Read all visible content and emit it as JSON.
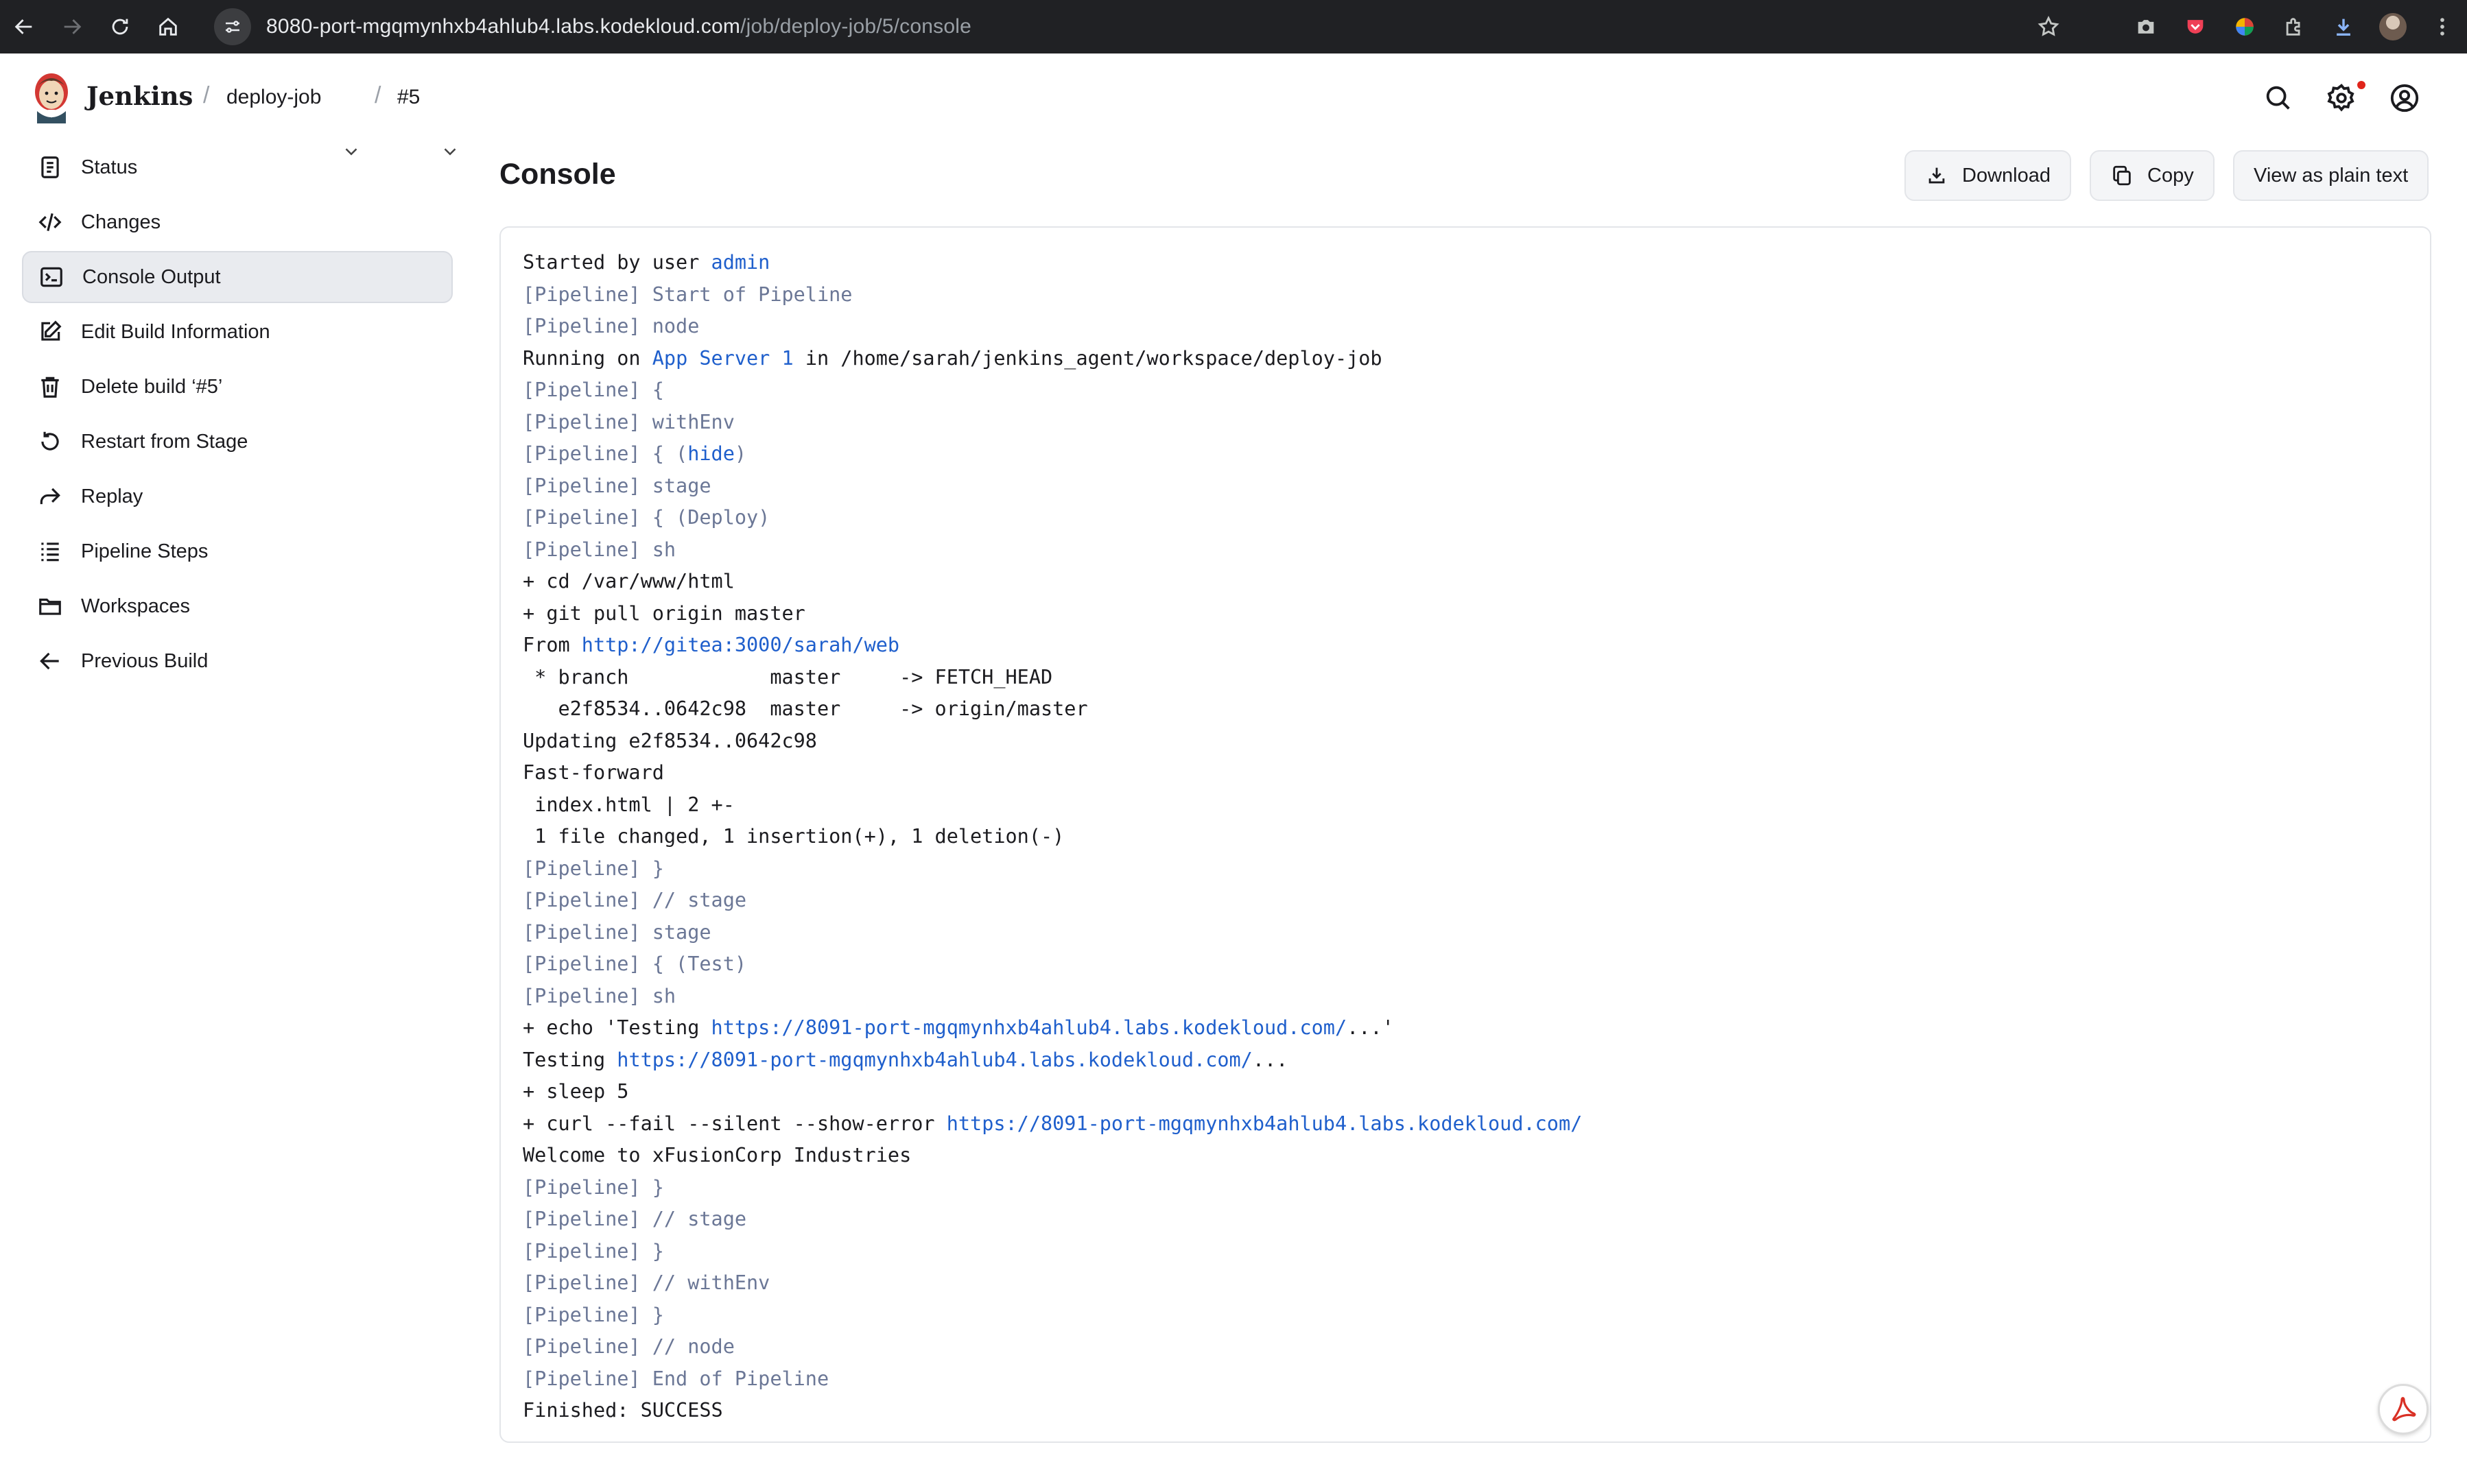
{
  "browser": {
    "url_host": "8080-port-mgqmynhxb4ahlub4.labs.kodekloud.com",
    "url_path": "/job/deploy-job/5/console"
  },
  "header": {
    "brand": "Jenkins",
    "breadcrumb": [
      {
        "label": "deploy-job"
      },
      {
        "label": "#5"
      }
    ],
    "separator": "/"
  },
  "sidebar": {
    "items": [
      {
        "label": "Status",
        "icon": "document-icon"
      },
      {
        "label": "Changes",
        "icon": "code-icon"
      },
      {
        "label": "Console Output",
        "icon": "terminal-icon",
        "active": true
      },
      {
        "label": "Edit Build Information",
        "icon": "edit-icon"
      },
      {
        "label": "Delete build ‘#5’",
        "icon": "trash-icon"
      },
      {
        "label": "Restart from Stage",
        "icon": "restart-icon"
      },
      {
        "label": "Replay",
        "icon": "replay-icon"
      },
      {
        "label": "Pipeline Steps",
        "icon": "list-icon"
      },
      {
        "label": "Workspaces",
        "icon": "folder-icon"
      },
      {
        "label": "Previous Build",
        "icon": "arrow-left-icon"
      }
    ]
  },
  "main": {
    "title": "Console",
    "buttons": {
      "download": "Download",
      "copy": "Copy",
      "plain_text": "View as plain text"
    }
  },
  "console": {
    "lines": [
      [
        {
          "t": "Started by user "
        },
        {
          "t": "admin",
          "c": "lnk"
        }
      ],
      [
        {
          "t": "[Pipeline] Start of Pipeline",
          "c": "pl"
        }
      ],
      [
        {
          "t": "[Pipeline] node",
          "c": "pl"
        }
      ],
      [
        {
          "t": "Running on "
        },
        {
          "t": "App Server 1",
          "c": "lnk"
        },
        {
          "t": " in /home/sarah/jenkins_agent/workspace/deploy-job"
        }
      ],
      [
        {
          "t": "[Pipeline] {",
          "c": "pl"
        }
      ],
      [
        {
          "t": "[Pipeline] withEnv",
          "c": "pl"
        }
      ],
      [
        {
          "t": "[Pipeline] { (",
          "c": "pl"
        },
        {
          "t": "hide",
          "c": "lnk"
        },
        {
          "t": ")",
          "c": "pl"
        }
      ],
      [
        {
          "t": "[Pipeline] stage",
          "c": "pl"
        }
      ],
      [
        {
          "t": "[Pipeline] { (Deploy)",
          "c": "pl"
        }
      ],
      [
        {
          "t": "[Pipeline] sh",
          "c": "pl"
        }
      ],
      [
        {
          "t": "+ cd /var/www/html"
        }
      ],
      [
        {
          "t": "+ git pull origin master"
        }
      ],
      [
        {
          "t": "From "
        },
        {
          "t": "http://gitea:3000/sarah/web",
          "c": "lnk"
        }
      ],
      [
        {
          "t": " * branch            master     -> FETCH_HEAD"
        }
      ],
      [
        {
          "t": "   e2f8534..0642c98  master     -> origin/master"
        }
      ],
      [
        {
          "t": "Updating e2f8534..0642c98"
        }
      ],
      [
        {
          "t": "Fast-forward"
        }
      ],
      [
        {
          "t": " index.html | 2 +-"
        }
      ],
      [
        {
          "t": " 1 file changed, 1 insertion(+), 1 deletion(-)"
        }
      ],
      [
        {
          "t": "[Pipeline] }",
          "c": "pl"
        }
      ],
      [
        {
          "t": "[Pipeline] // stage",
          "c": "pl"
        }
      ],
      [
        {
          "t": "[Pipeline] stage",
          "c": "pl"
        }
      ],
      [
        {
          "t": "[Pipeline] { (Test)",
          "c": "pl"
        }
      ],
      [
        {
          "t": "[Pipeline] sh",
          "c": "pl"
        }
      ],
      [
        {
          "t": "+ echo 'Testing "
        },
        {
          "t": "https://8091-port-mgqmynhxb4ahlub4.labs.kodekloud.com/",
          "c": "lnk"
        },
        {
          "t": "...'"
        }
      ],
      [
        {
          "t": "Testing "
        },
        {
          "t": "https://8091-port-mgqmynhxb4ahlub4.labs.kodekloud.com/",
          "c": "lnk"
        },
        {
          "t": "..."
        }
      ],
      [
        {
          "t": "+ sleep 5"
        }
      ],
      [
        {
          "t": "+ curl --fail --silent --show-error "
        },
        {
          "t": "https://8091-port-mgqmynhxb4ahlub4.labs.kodekloud.com/",
          "c": "lnk"
        }
      ],
      [
        {
          "t": "Welcome to xFusionCorp Industries"
        }
      ],
      [
        {
          "t": "[Pipeline] }",
          "c": "pl"
        }
      ],
      [
        {
          "t": "[Pipeline] // stage",
          "c": "pl"
        }
      ],
      [
        {
          "t": "[Pipeline] }",
          "c": "pl"
        }
      ],
      [
        {
          "t": "[Pipeline] // withEnv",
          "c": "pl"
        }
      ],
      [
        {
          "t": "[Pipeline] }",
          "c": "pl"
        }
      ],
      [
        {
          "t": "[Pipeline] // node",
          "c": "pl"
        }
      ],
      [
        {
          "t": "[Pipeline] End of Pipeline",
          "c": "pl"
        }
      ],
      [
        {
          "t": "Finished: SUCCESS"
        }
      ]
    ]
  },
  "colors": {
    "pipeline_text": "#6b7796",
    "link": "#1f5fcc",
    "active_bg": "#e9ebef"
  }
}
